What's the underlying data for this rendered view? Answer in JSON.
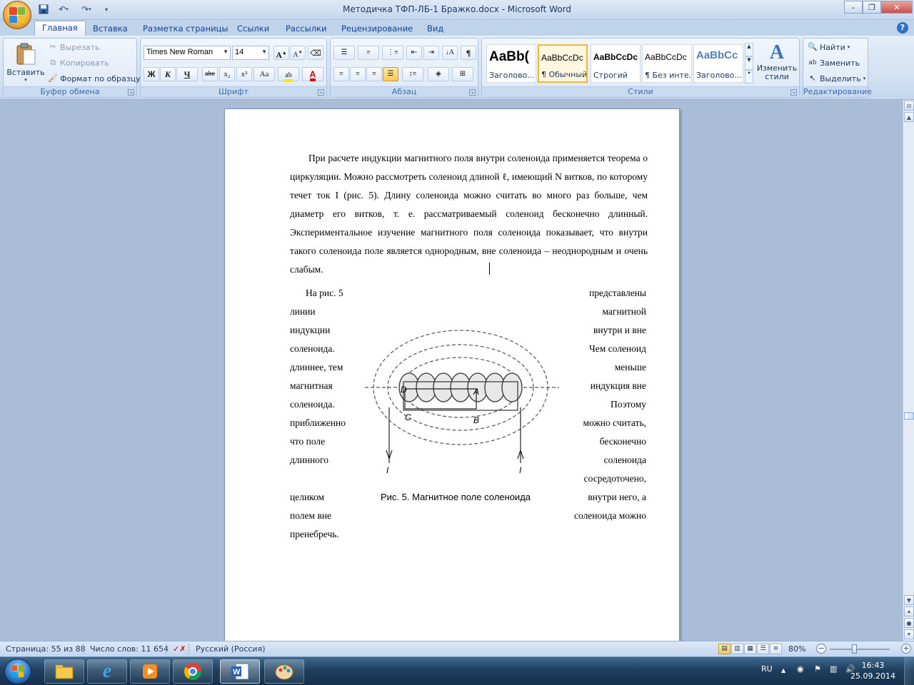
{
  "window": {
    "title": "Методичка ТФП-ЛБ-1 Бражко.docx - Microsoft Word",
    "minimize": "–",
    "maximize": "❐",
    "close": "✕"
  },
  "tabs": [
    {
      "label": "Главная"
    },
    {
      "label": "Вставка"
    },
    {
      "label": "Разметка страницы"
    },
    {
      "label": "Ссылки"
    },
    {
      "label": "Рассылки"
    },
    {
      "label": "Рецензирование"
    },
    {
      "label": "Вид"
    }
  ],
  "ribbon": {
    "clipboard": {
      "label": "Буфер обмена",
      "paste": "Вставить",
      "cut": "Вырезать",
      "copy": "Копировать",
      "format_painter": "Формат по образцу"
    },
    "font": {
      "label": "Шрифт",
      "font_name": "Times New Roman",
      "font_size": "14",
      "bold": "Ж",
      "italic": "К",
      "underline": "Ч",
      "strike": "abe",
      "subscript": "x₂",
      "superscript": "x²",
      "change_case": "Aa",
      "grow": "A",
      "shrink": "A"
    },
    "paragraph": {
      "label": "Абзац",
      "show_marks": "¶"
    },
    "styles": {
      "label": "Стили",
      "items": [
        {
          "sample": "AaBb(",
          "name": "Заголово..."
        },
        {
          "sample": "AaBbCcDc",
          "name": "¶ Обычный"
        },
        {
          "sample": "AaBbCcDc",
          "name": "Строгий"
        },
        {
          "sample": "AaBbCcDc",
          "name": "¶ Без инте..."
        },
        {
          "sample": "AaBbCc",
          "name": "Заголово..."
        }
      ],
      "change_styles": "Изменить стили"
    },
    "editing": {
      "label": "Редактирование",
      "find": "Найти",
      "replace": "Заменить",
      "select": "Выделить"
    }
  },
  "document": {
    "paragraph1": "При расчете индукции магнитного поля внутри соленоида применяется теорема о циркуляции. Можно рассмотреть соленоид длиной ℓ, имеющий N витков, по которому течет ток I (рис. 5). Длину соленоида можно считать во много раз больше, чем диаметр его витков, т. е. рассматриваемый соленоид бесконечно длинный. Экспериментальное изучение магнитного поля соленоида показывает, что внутри такого соленоида поле является однородным, вне соленоида – неоднородным и очень слабым.",
    "wrap_left": [
      "На рис. 5",
      "линии",
      "индукции",
      "соленоида.",
      "длиннее, тем",
      "магнитная",
      "соленоида.",
      "приближенно",
      "что поле",
      "длинного",
      "",
      "целиком",
      "полем вне",
      "пренебречь."
    ],
    "wrap_right": [
      "представлены",
      "магнитной",
      "внутри и вне",
      "Чем соленоид",
      "меньше",
      "индукция вне",
      "Поэтому",
      "можно считать,",
      "бесконечно",
      "соленоида",
      "сосредоточено,",
      "внутри него, а",
      "соленоида можно",
      ""
    ],
    "figure": {
      "caption": "Рис. 5. Магнитное поле соленоида",
      "labels": {
        "D": "D",
        "A": "A",
        "C": "C",
        "B": "B",
        "I_left": "I",
        "I_right": "I"
      }
    }
  },
  "status": {
    "page": "Страница: 55 из 88",
    "words": "Число слов: 11 654",
    "language": "Русский (Россия)",
    "zoom": "80%",
    "zoom_level": 0.8
  },
  "taskbar": {
    "lang": "RU",
    "time": "16:43",
    "date": "25.09.2014"
  },
  "colors": {
    "accent": "#15428b",
    "ribbon": "#dde8f6",
    "doc_background": "#a9bdd6",
    "taskbar": "#1f3f5e"
  }
}
